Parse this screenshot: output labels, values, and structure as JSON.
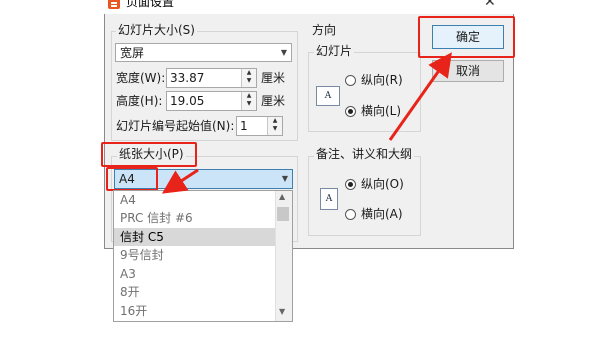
{
  "window": {
    "title": "页面设置",
    "close_glyph": "✕"
  },
  "slide_size": {
    "group_label": "幻灯片大小(S)",
    "preset": "宽屏",
    "width_label": "宽度(W):",
    "width_value": "33.87",
    "width_unit": "厘米",
    "height_label": "高度(H):",
    "height_value": "19.05",
    "height_unit": "厘米",
    "start_num_label": "幻灯片编号起始值(N):",
    "start_num_value": "1"
  },
  "paper_size": {
    "label": "纸张大小(P)",
    "selected": "A4",
    "options": [
      "A4",
      "PRC 信封 #6",
      "信封 C5",
      "9号信封",
      "A3",
      "8开",
      "16开"
    ],
    "highlighted_option": "信封 C5"
  },
  "orientation": {
    "group_label": "方向",
    "slides_label": "幻灯片",
    "slides_portrait": "纵向(R)",
    "slides_landscape": "横向(L)",
    "slides_selected": "横向(L)",
    "notes_label": "备注、讲义和大纲",
    "notes_portrait": "纵向(O)",
    "notes_landscape": "横向(A)",
    "notes_selected": "纵向(O)",
    "page_icon_letter": "A"
  },
  "buttons": {
    "ok": "确定",
    "cancel": "取消"
  },
  "colors": {
    "annotation_red": "#e8241a",
    "dialog_bg": "#f0f0f0",
    "primary_border": "#3c7fb1"
  },
  "icons": {
    "app": "presentation-app-icon",
    "close": "close-icon",
    "dropdown": "chevron-down-icon",
    "spin": "spin-up-down-icon",
    "page_portrait": "portrait-page-icon",
    "page_landscape": "landscape-page-icon"
  }
}
